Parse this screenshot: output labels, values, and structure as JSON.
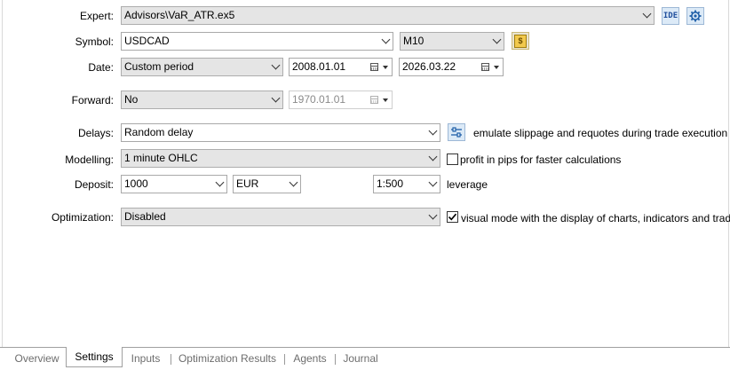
{
  "expert": {
    "label": "Expert:",
    "value": "Advisors\\VaR_ATR.ex5",
    "ide_label": "IDE",
    "settings_icon": "gear-icon"
  },
  "symbol": {
    "label": "Symbol:",
    "value": "USDCAD",
    "timeframe": "M10",
    "spec_icon": "dollar-icon",
    "spec_color": "#f2c94c"
  },
  "date": {
    "label": "Date:",
    "period": "Custom period",
    "from": "2008.01.01",
    "to": "2026.03.22"
  },
  "forward": {
    "label": "Forward:",
    "value": "No",
    "date": "1970.01.01"
  },
  "delays": {
    "label": "Delays:",
    "value": "Random delay",
    "note": "emulate slippage and requotes during trade execution",
    "settings_icon": "sliders-icon"
  },
  "modelling": {
    "label": "Modelling:",
    "value": "1 minute OHLC",
    "checkbox_label": "profit in pips for faster calculations",
    "checked": false
  },
  "deposit": {
    "label": "Deposit:",
    "amount": "1000",
    "currency": "EUR",
    "leverage": "1:500",
    "leverage_label": "leverage"
  },
  "optimization": {
    "label": "Optimization:",
    "value": "Disabled",
    "checkbox_label": "visual mode with the display of charts, indicators and trades",
    "checked": true
  },
  "tabs": [
    {
      "label": "Overview"
    },
    {
      "label": "Settings"
    },
    {
      "label": "Inputs"
    },
    {
      "label": "Optimization Results"
    },
    {
      "label": "Agents"
    },
    {
      "label": "Journal"
    }
  ],
  "active_tab": "Settings"
}
